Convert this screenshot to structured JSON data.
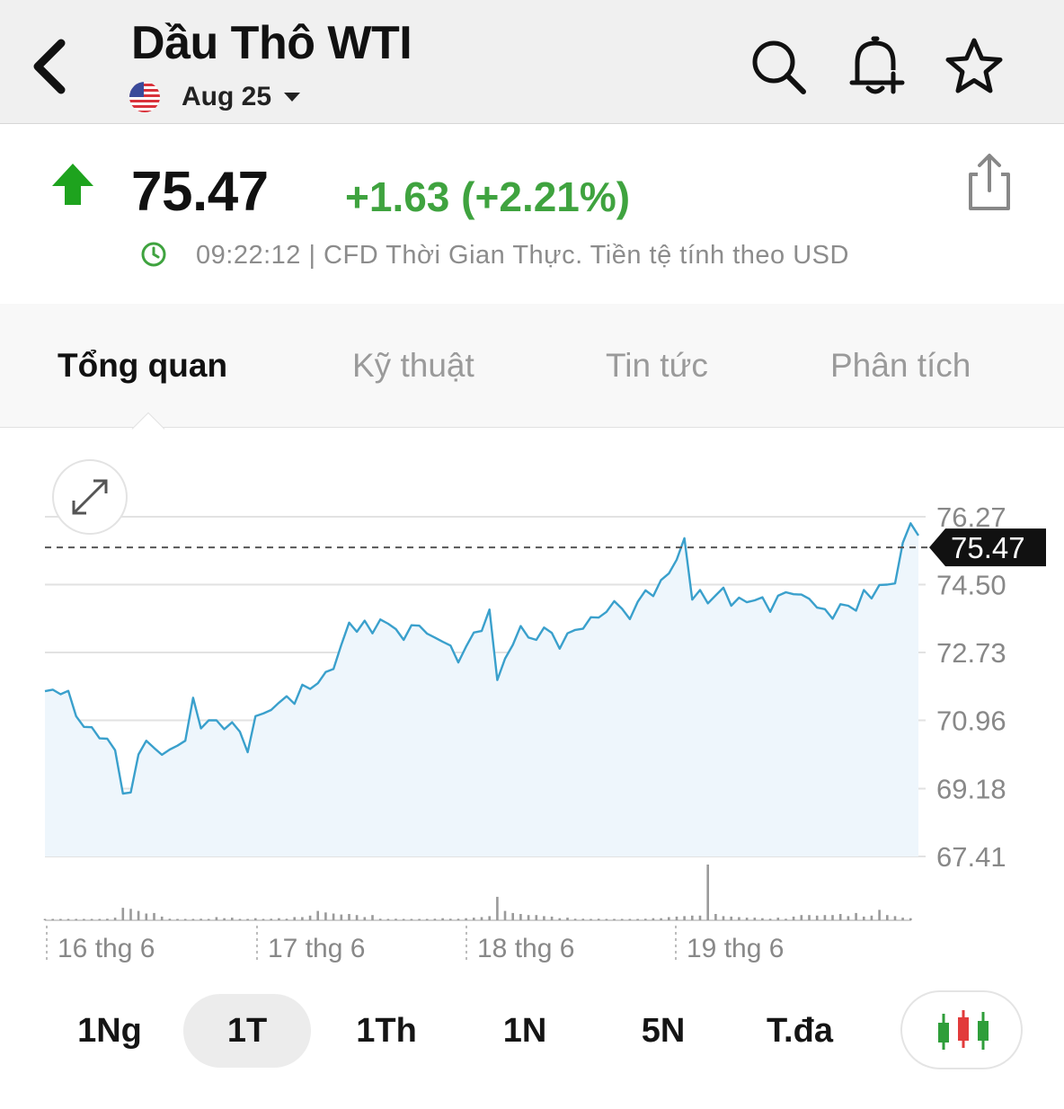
{
  "header": {
    "title": "Dầu Thô WTI",
    "contract": "Aug 25",
    "icons": [
      "back-icon",
      "search-icon",
      "bell-plus-icon",
      "star-icon"
    ]
  },
  "quote": {
    "price": "75.47",
    "change": "+1.63 (+2.21%)",
    "direction": "up",
    "status": "09:22:12 | CFD Thời Gian Thực. Tiền tệ tính theo USD",
    "colors": {
      "up": "#3fa33f",
      "up_arrow": "#1ea31e"
    }
  },
  "tabs": [
    {
      "label": "Tổng quan",
      "active": true
    },
    {
      "label": "Kỹ thuật",
      "active": false
    },
    {
      "label": "Tin tức",
      "active": false
    },
    {
      "label": "Phân tích",
      "active": false
    }
  ],
  "chart_data": {
    "type": "area",
    "y_ticks": [
      "76.27",
      "74.50",
      "72.73",
      "70.96",
      "69.18",
      "67.41"
    ],
    "ylim": [
      67.41,
      76.27
    ],
    "last_price_label": "75.47",
    "last_price": 75.47,
    "x_labels": [
      "16 thg 6",
      "17 thg 6",
      "18 thg 6",
      "19 thg 6"
    ],
    "line_color": "#3aa0cc",
    "series": [
      {
        "values": [
          71.72,
          71.76,
          71.64,
          71.73,
          71.07,
          70.79,
          70.78,
          70.49,
          70.48,
          70.18,
          69.05,
          69.08,
          70.07,
          70.43,
          70.24,
          70.06,
          70.2,
          70.3,
          70.43,
          71.55,
          70.75,
          70.96,
          70.96,
          70.73,
          70.91,
          70.66,
          70.13,
          71.07,
          71.14,
          71.23,
          71.42,
          71.59,
          71.39,
          71.89,
          71.78,
          71.93,
          72.22,
          72.3,
          72.93,
          73.51,
          73.27,
          73.56,
          73.23,
          73.59,
          73.48,
          73.34,
          73.06,
          73.44,
          73.43,
          73.22,
          73.12,
          73.01,
          72.91,
          72.47,
          72.88,
          73.25,
          73.29,
          73.85,
          72.01,
          72.57,
          72.93,
          73.42,
          73.12,
          73.06,
          73.38,
          73.24,
          72.83,
          73.23,
          73.32,
          73.35,
          73.65,
          73.64,
          73.79,
          74.07,
          73.87,
          73.6,
          74.05,
          74.35,
          74.2,
          74.62,
          74.79,
          75.15,
          75.71,
          74.11,
          74.36,
          74.01,
          74.22,
          74.42,
          73.95,
          74.16,
          74.04,
          74.09,
          74.17,
          73.79,
          74.21,
          74.3,
          74.25,
          74.24,
          74.13,
          73.9,
          73.86,
          73.61,
          73.99,
          73.95,
          73.82,
          74.36,
          74.14,
          74.49,
          74.5,
          74.53,
          75.59,
          76.1,
          75.78
        ]
      },
      {
        "name": "volume",
        "values": [
          1,
          1,
          1,
          2,
          2,
          1,
          2,
          2,
          3,
          5,
          24,
          22,
          18,
          13,
          14,
          7,
          3,
          1,
          2,
          2,
          3,
          1,
          6,
          4,
          5,
          2,
          1,
          4,
          2,
          3,
          4,
          3,
          6,
          6,
          9,
          18,
          15,
          13,
          11,
          12,
          10,
          6,
          10,
          3,
          2,
          3,
          2,
          2,
          2,
          2,
          3,
          4,
          3,
          3,
          4,
          5,
          6,
          8,
          45,
          18,
          14,
          12,
          10,
          10,
          8,
          7,
          4,
          5,
          3,
          3,
          2,
          3,
          2,
          2,
          2,
          2,
          2,
          3,
          4,
          4,
          6,
          7,
          8,
          9,
          9,
          107,
          12,
          8,
          7,
          6,
          5,
          5,
          4,
          3,
          5,
          3,
          7,
          10,
          10,
          9,
          10,
          10,
          12,
          8,
          14,
          7,
          9,
          20,
          10,
          8,
          5,
          4
        ]
      }
    ],
    "grid": true,
    "legend": "none"
  },
  "periods": [
    {
      "label": "1Ng",
      "active": false
    },
    {
      "label": "1T",
      "active": true
    },
    {
      "label": "1Th",
      "active": false
    },
    {
      "label": "1N",
      "active": false
    },
    {
      "label": "5N",
      "active": false
    },
    {
      "label": "T.đa",
      "active": false
    }
  ],
  "candle_button": {
    "icon": "candlestick-icon"
  }
}
